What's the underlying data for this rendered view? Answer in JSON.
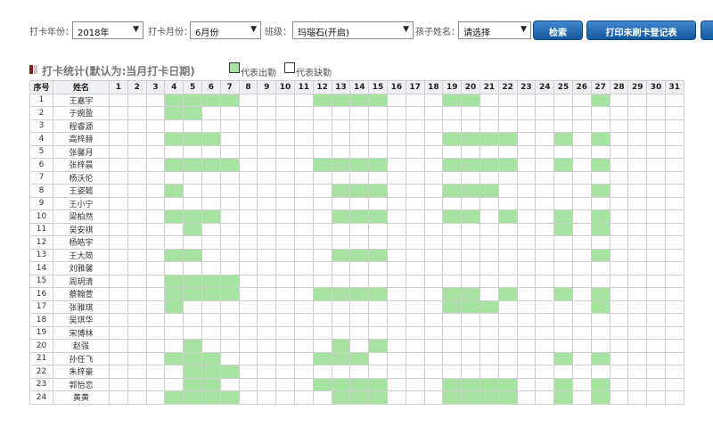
{
  "filters": {
    "year_label": "打卡年份：",
    "year_value": "2018年",
    "month_label": "打卡月份：",
    "month_value": "6月份",
    "class_label": "班级：",
    "class_value": "玛瑙石(开启)",
    "child_label": "孩子姓名：",
    "child_value": "请选择"
  },
  "buttons": {
    "search": "检索",
    "print": "打印未刷卡登记表"
  },
  "section": {
    "title": "打卡统计(默认为:当月打卡日期)",
    "legend_present": "代表出勤",
    "legend_absent": "代表缺勤"
  },
  "colors": {
    "present": "#a6e3a1",
    "button": "#1f64ad"
  },
  "table": {
    "col_index": "序号",
    "col_name": "姓名",
    "days": [
      "1",
      "2",
      "3",
      "4",
      "5",
      "6",
      "7",
      "8",
      "9",
      "10",
      "11",
      "12",
      "13",
      "14",
      "15",
      "16",
      "17",
      "18",
      "19",
      "20",
      "21",
      "22",
      "23",
      "24",
      "25",
      "26",
      "27",
      "28",
      "29",
      "30",
      "31"
    ],
    "rows": [
      {
        "no": "1",
        "name": "王嘉宇",
        "present": [
          4,
          5,
          6,
          7,
          12,
          13,
          14,
          15,
          19,
          20,
          27
        ]
      },
      {
        "no": "2",
        "name": "于婉盈",
        "present": [
          4,
          5
        ]
      },
      {
        "no": "3",
        "name": "程睿源",
        "present": []
      },
      {
        "no": "4",
        "name": "高梓赫",
        "present": [
          4,
          5,
          6,
          19,
          20,
          21,
          22,
          25,
          27
        ]
      },
      {
        "no": "5",
        "name": "张馨月",
        "present": []
      },
      {
        "no": "6",
        "name": "张梓晨",
        "present": [
          4,
          5,
          6,
          7,
          12,
          13,
          14,
          15,
          19,
          20,
          21,
          22,
          25,
          27
        ]
      },
      {
        "no": "7",
        "name": "杨沃伦",
        "present": []
      },
      {
        "no": "8",
        "name": "王姿懿",
        "present": [
          4,
          13,
          14,
          15,
          19,
          20,
          21,
          27
        ]
      },
      {
        "no": "9",
        "name": "王小宁",
        "present": []
      },
      {
        "no": "10",
        "name": "梁柏然",
        "present": [
          4,
          5,
          6,
          13,
          14,
          15,
          19,
          20,
          22,
          25,
          27
        ]
      },
      {
        "no": "11",
        "name": "吴安祺",
        "present": [
          5,
          25,
          27
        ]
      },
      {
        "no": "12",
        "name": "杨皓宇",
        "present": []
      },
      {
        "no": "13",
        "name": "王大简",
        "present": [
          4,
          5,
          13,
          14,
          15,
          27
        ]
      },
      {
        "no": "14",
        "name": "刘雅馨",
        "present": []
      },
      {
        "no": "15",
        "name": "周玥清",
        "present": [
          4,
          5,
          6,
          7
        ]
      },
      {
        "no": "16",
        "name": "蔡翰萱",
        "present": [
          4,
          5,
          6,
          7,
          12,
          13,
          14,
          15,
          19,
          20,
          22,
          25,
          27
        ]
      },
      {
        "no": "17",
        "name": "张雅琪",
        "present": [
          4,
          19,
          20,
          21,
          27
        ]
      },
      {
        "no": "18",
        "name": "吴琪华",
        "present": []
      },
      {
        "no": "19",
        "name": "宋博林",
        "present": []
      },
      {
        "no": "20",
        "name": "赵强",
        "present": [
          5,
          13,
          15
        ]
      },
      {
        "no": "21",
        "name": "孙任飞",
        "present": [
          4,
          5,
          6,
          12,
          13,
          14,
          25,
          27
        ]
      },
      {
        "no": "22",
        "name": "朱梓豪",
        "present": [
          5,
          6,
          7
        ]
      },
      {
        "no": "23",
        "name": "郭怡恋",
        "present": [
          5,
          6,
          12,
          13,
          14,
          15,
          19,
          20,
          21,
          22,
          25,
          27
        ]
      },
      {
        "no": "24",
        "name": "黄黄",
        "present": [
          4,
          5,
          6,
          7,
          13,
          14,
          15,
          19,
          20,
          21,
          22,
          25,
          27
        ]
      }
    ]
  }
}
